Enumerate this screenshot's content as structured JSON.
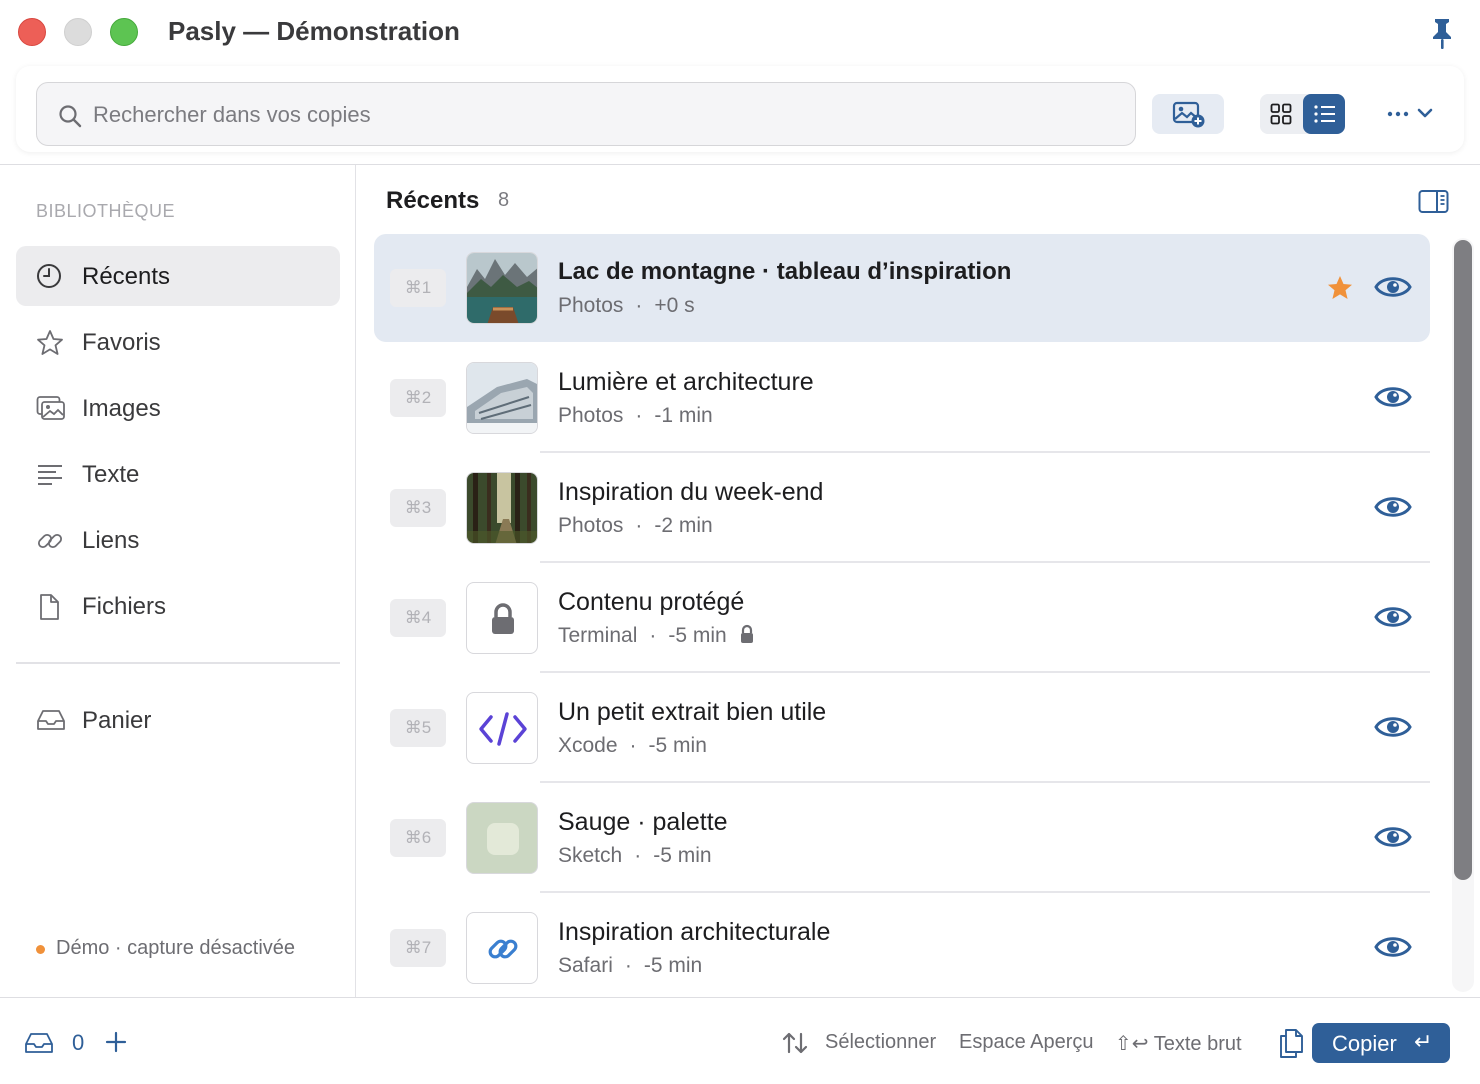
{
  "window": {
    "title": "Pasly — Démonstration"
  },
  "toolbar": {
    "search_placeholder": "Rechercher dans vos copies",
    "more_label": "···"
  },
  "sidebar": {
    "section_title": "BIBLIOTHÈQUE",
    "items": [
      {
        "label": "Récents",
        "icon": "clock-icon",
        "active": true
      },
      {
        "label": "Favoris",
        "icon": "star-icon",
        "active": false
      },
      {
        "label": "Images",
        "icon": "images-icon",
        "active": false
      },
      {
        "label": "Texte",
        "icon": "text-lines-icon",
        "active": false
      },
      {
        "label": "Liens",
        "icon": "link-icon",
        "active": false
      },
      {
        "label": "Fichiers",
        "icon": "file-icon",
        "active": false
      }
    ],
    "tray": {
      "label": "Panier",
      "icon": "tray-icon"
    },
    "status": "Démo · capture désactivée"
  },
  "list": {
    "title": "Récents",
    "count": "8",
    "items": [
      {
        "shortcut": "⌘1",
        "title": "Lac de montagne · tableau d’inspiration",
        "source": "Photos",
        "time": "+0 s",
        "thumb": "mountain-lake-photo",
        "favorite": true,
        "selected": true,
        "locked": false
      },
      {
        "shortcut": "⌘2",
        "title": "Lumière et architecture",
        "source": "Photos",
        "time": "-1 min",
        "thumb": "architecture-photo",
        "favorite": false,
        "selected": false,
        "locked": false
      },
      {
        "shortcut": "⌘3",
        "title": "Inspiration du week-end",
        "source": "Photos",
        "time": "-2 min",
        "thumb": "forest-photo",
        "favorite": false,
        "selected": false,
        "locked": false
      },
      {
        "shortcut": "⌘4",
        "title": "Contenu protégé",
        "source": "Terminal",
        "time": "-5 min",
        "thumb": "lock-icon",
        "favorite": false,
        "selected": false,
        "locked": true
      },
      {
        "shortcut": "⌘5",
        "title": "Un petit extrait bien utile",
        "source": "Xcode",
        "time": "-5 min",
        "thumb": "code-icon",
        "favorite": false,
        "selected": false,
        "locked": false
      },
      {
        "shortcut": "⌘6",
        "title": "Sauge · palette",
        "source": "Sketch",
        "time": "-5 min",
        "thumb": "color-swatch",
        "favorite": false,
        "selected": false,
        "locked": false
      },
      {
        "shortcut": "⌘7",
        "title": "Inspiration architecturale",
        "source": "Safari",
        "time": "-5 min",
        "thumb": "link-icon",
        "favorite": false,
        "selected": false,
        "locked": false
      }
    ]
  },
  "footer": {
    "tray_count": "0",
    "hint_select": "Sélectionner",
    "hint_preview": "Espace Aperçu",
    "hint_raw": "⇧↩ Texte brut",
    "copy_label": "Copier",
    "copy_key": "↵"
  },
  "colors": {
    "accent": "#2f5f98",
    "selected_row": "#e3e9f2",
    "favorite_star": "#f0913a",
    "status_dot": "#f0913a",
    "code_icon": "#5b43d6",
    "link_icon": "#3a7fd0",
    "sage_swatch": "#cbd7c2"
  }
}
